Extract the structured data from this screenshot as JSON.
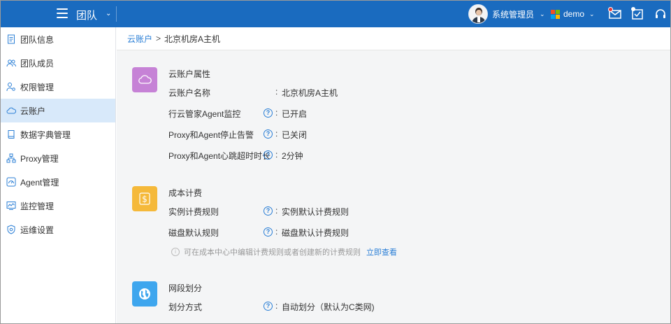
{
  "header": {
    "team_title": "团队",
    "username": "系统管理员",
    "org_name": "demo"
  },
  "sidebar": {
    "items": [
      {
        "label": "团队信息"
      },
      {
        "label": "团队成员"
      },
      {
        "label": "权限管理"
      },
      {
        "label": "云账户"
      },
      {
        "label": "数据字典管理"
      },
      {
        "label": "Proxy管理"
      },
      {
        "label": "Agent管理"
      },
      {
        "label": "监控管理"
      },
      {
        "label": "运维设置"
      }
    ]
  },
  "breadcrumb": {
    "parent": "云账户",
    "separator": ">",
    "current": "北京机房A主机"
  },
  "sections": {
    "properties": {
      "title": "云账户属性",
      "rows": [
        {
          "label": "云账户名称",
          "colon": ":",
          "value": "北京机房A主机"
        },
        {
          "label": "行云管家Agent监控",
          "colon": ":",
          "value": "已开启"
        },
        {
          "label": "Proxy和Agent停止告警",
          "colon": ":",
          "value": "已关闭"
        },
        {
          "label": "Proxy和Agent心跳超时时长",
          "colon": ":",
          "value": "2分钟"
        }
      ]
    },
    "billing": {
      "title": "成本计费",
      "rows": [
        {
          "label": "实例计费规则",
          "colon": ":",
          "value": "实例默认计费规则"
        },
        {
          "label": "磁盘默认规则",
          "colon": ":",
          "value": "磁盘默认计费规则"
        }
      ],
      "note": "可在成本中心中编辑计费规则或者创建新的计费规则",
      "note_link": "立即查看"
    },
    "network": {
      "title": "网段划分",
      "rows": [
        {
          "label": "划分方式",
          "colon": ":",
          "value": "自动划分（默认为C类网)"
        }
      ]
    }
  },
  "colors": {
    "topbar": "#1a6bbf",
    "active_item": "#d8e9fa",
    "link": "#2b7fd6",
    "cloud_icon_bg": "#c682d6",
    "billing_icon_bg": "#f5b93a",
    "network_icon_bg": "#3ea6ee"
  }
}
